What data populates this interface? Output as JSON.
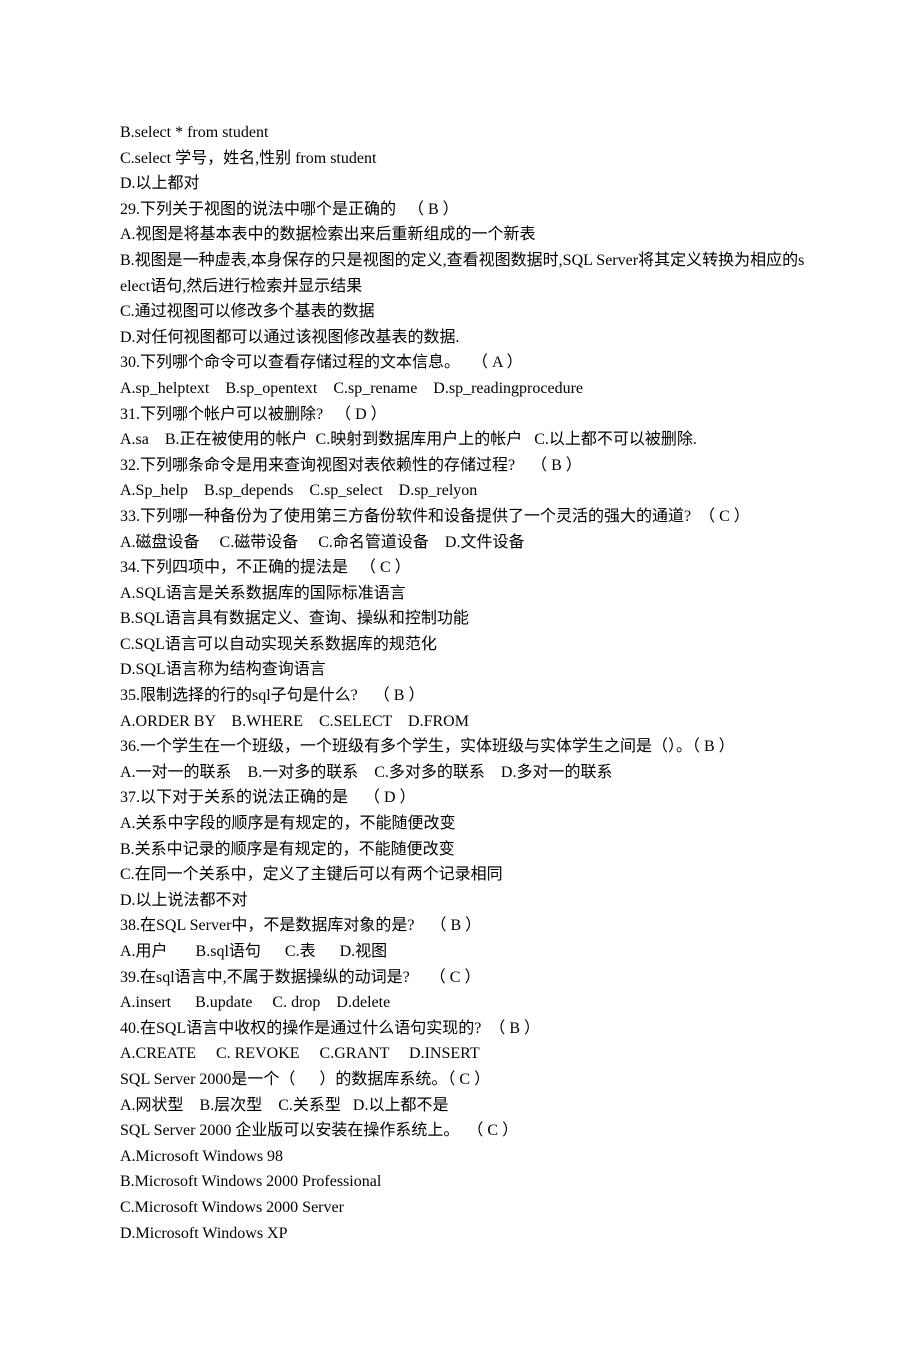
{
  "lines": [
    "B.select * from student",
    "C.select 学号，姓名,性别 from student",
    "D.以上都对",
    "29.下列关于视图的说法中哪个是正确的   （ B ）",
    "A.视图是将基本表中的数据检索出来后重新组成的一个新表",
    "B.视图是一种虚表,本身保存的只是视图的定义,查看视图数据时,SQL Server将其定义转换为相应的select语句,然后进行检索并显示结果",
    "C.通过视图可以修改多个基表的数据",
    "D.对任何视图都可以通过该视图修改基表的数据.",
    "30.下列哪个命令可以查看存储过程的文本信息。   （ A ）",
    "A.sp_helptext    B.sp_opentext    C.sp_rename    D.sp_readingprocedure",
    "31.下列哪个帐户可以被删除?   （ D ）",
    "A.sa    B.正在被使用的帐户  C.映射到数据库用户上的帐户   C.以上都不可以被删除.",
    "32.下列哪条命令是用来查询视图对表依赖性的存储过程?    （ B ）",
    "A.Sp_help    B.sp_depends    C.sp_select    D.sp_relyon",
    "33.下列哪一种备份为了使用第三方备份软件和设备提供了一个灵活的强大的通道?  （ C ）",
    "A.磁盘设备     C.磁带设备     C.命名管道设备    D.文件设备",
    "34.下列四项中，不正确的提法是   （ C ）",
    "A.SQL语言是关系数据库的国际标准语言",
    "B.SQL语言具有数据定义、查询、操纵和控制功能",
    "C.SQL语言可以自动实现关系数据库的规范化",
    "D.SQL语言称为结构查询语言",
    "35.限制选择的行的sql子句是什么?    （ B ）",
    "A.ORDER BY    B.WHERE    C.SELECT    D.FROM",
    "36.一个学生在一个班级，一个班级有多个学生，实体班级与实体学生之间是（）。（ B ）",
    "A.一对一的联系    B.一对多的联系    C.多对多的联系    D.多对一的联系",
    "37.以下对于关系的说法正确的是    （ D ）",
    "A.关系中字段的顺序是有规定的，不能随便改变",
    "B.关系中记录的顺序是有规定的，不能随便改变",
    "C.在同一个关系中，定义了主键后可以有两个记录相同",
    "D.以上说法都不对",
    "38.在SQL Server中，不是数据库对象的是?    （ B ）",
    "A.用户       B.sql语句      C.表      D.视图",
    "39.在sql语言中,不属于数据操纵的动词是?     （ C ）",
    "A.insert      B.update     C. drop    D.delete",
    "40.在SQL语言中收权的操作是通过什么语句实现的?  （ B ）",
    "A.CREATE     C. REVOKE     C.GRANT     D.INSERT",
    "SQL Server 2000是一个（      ）的数据库系统。（ C ）",
    "A.网状型    B.层次型    C.关系型   D.以上都不是",
    "SQL Server 2000 企业版可以安装在操作系统上。  （ C ）",
    "A.Microsoft Windows 98",
    "B.Microsoft Windows 2000 Professional",
    "C.Microsoft Windows 2000 Server",
    "D.Microsoft Windows XP"
  ]
}
